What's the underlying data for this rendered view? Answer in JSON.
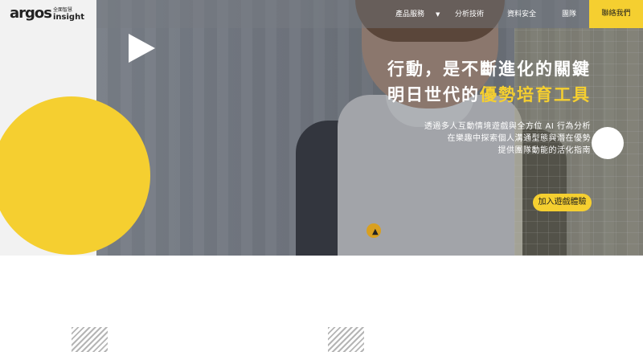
{
  "logo": {
    "mark": "argos",
    "chinese": "全面智慧",
    "english": "insight"
  },
  "nav": {
    "items": [
      {
        "label": "產品服務",
        "dropdown": true
      },
      {
        "label": "分析技術"
      },
      {
        "label": "資料安全"
      },
      {
        "label": "團隊"
      }
    ],
    "contact_label": "聯絡我們"
  },
  "hero": {
    "headline_line1": "行動，是不斷進化的關鍵",
    "headline_line2_prefix": "明日世代的",
    "headline_line2_highlight": "優勢培育工具",
    "description_line1": "透過多人互動情境遊戲與全方位 AI 行為分析",
    "description_line2": "在樂趣中探索個人溝通型態與潛在優勢",
    "description_line3": "提供團隊動能的活化指南",
    "cta_label": "加入遊戲體驗"
  },
  "colors": {
    "accent": "#f5cf30",
    "text_dark": "#1e1e1e",
    "hero_overlay": "#5f646c"
  },
  "icons": {
    "play": "play-icon",
    "caret": "caret-down-icon"
  }
}
